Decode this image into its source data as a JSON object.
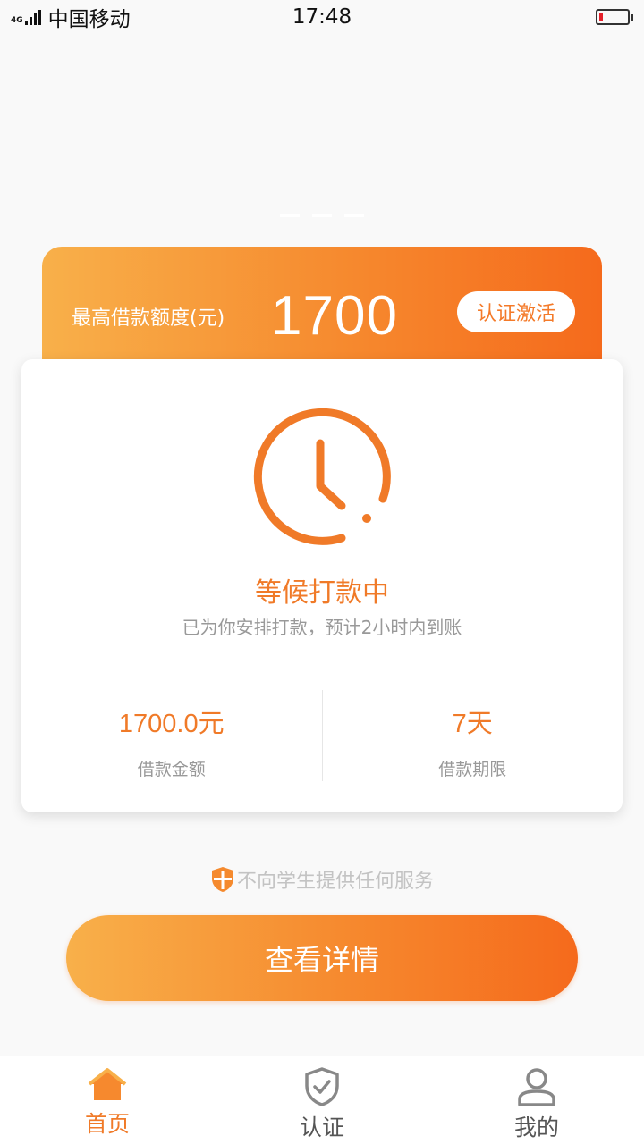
{
  "status_bar": {
    "network_label": "4G",
    "carrier": "中国移动",
    "time": "17:48"
  },
  "limit_card": {
    "label": "最高借款额度(元)",
    "amount": "1700",
    "activate_label": "认证激活"
  },
  "loan_status": {
    "title": "等候打款中",
    "subtitle": "已为你安排打款，预计2小时内到账",
    "amount_value": "1700.0元",
    "amount_label": "借款金额",
    "term_value": "7天",
    "term_label": "借款期限"
  },
  "notice": {
    "text": "不向学生提供任何服务"
  },
  "details_button": {
    "label": "查看详情"
  },
  "tab_bar": {
    "tabs": [
      {
        "label": "首页",
        "icon": "home-icon",
        "active": true
      },
      {
        "label": "认证",
        "icon": "shield-check-icon",
        "active": false
      },
      {
        "label": "我的",
        "icon": "user-icon",
        "active": false
      }
    ]
  },
  "colors": {
    "accent": "#f07a28",
    "gradient_start": "#f8b04a",
    "gradient_end": "#f56a1c"
  }
}
